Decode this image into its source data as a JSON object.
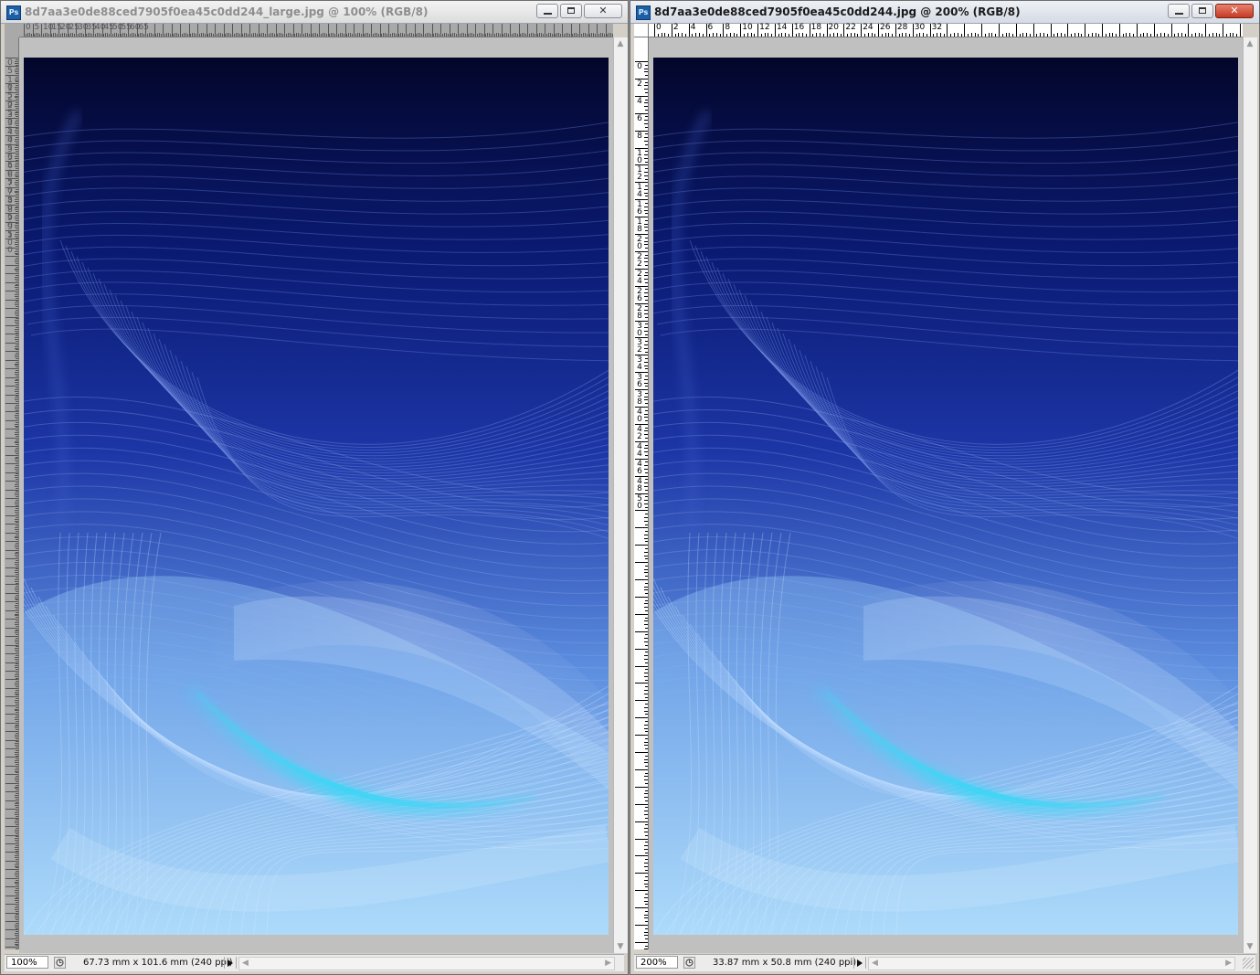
{
  "windows": [
    {
      "title": "8d7aa3e0de88ced7905f0ea45c0dd244_large.jpg @ 100% (RGB/8)",
      "app_icon": "Ps",
      "active": false,
      "zoom": "100%",
      "doc_info": "67.73 mm x 101.6 mm (240 ppi)",
      "ruler_h_labels": [
        "0",
        "5",
        "10",
        "15",
        "20",
        "25",
        "30",
        "35",
        "40",
        "45",
        "50",
        "55",
        "60",
        "65"
      ],
      "ruler_v_labels": [
        "0",
        "5",
        "10",
        "15",
        "20",
        "25",
        "30",
        "35",
        "40",
        "45",
        "50",
        "55",
        "60",
        "65",
        "70",
        "75",
        "80",
        "85",
        "90",
        "95",
        "100"
      ]
    },
    {
      "title": "8d7aa3e0de88ced7905f0ea45c0dd244.jpg @ 200% (RGB/8)",
      "app_icon": "Ps",
      "active": true,
      "zoom": "200%",
      "doc_info": "33.87 mm x 50.8 mm (240 ppi)",
      "ruler_h_labels": [
        "0",
        "2",
        "4",
        "6",
        "8",
        "10",
        "12",
        "14",
        "16",
        "18",
        "20",
        "22",
        "24",
        "26",
        "28",
        "30",
        "32"
      ],
      "ruler_v_labels": [
        "0",
        "2",
        "4",
        "6",
        "8",
        "10",
        "12",
        "14",
        "16",
        "18",
        "20",
        "22",
        "24",
        "26",
        "28",
        "30",
        "32",
        "34",
        "36",
        "38",
        "40",
        "42",
        "44",
        "46",
        "48",
        "50"
      ]
    }
  ],
  "icons": {
    "minimize": "minimize-icon",
    "restore": "restore-icon",
    "close": "close-icon",
    "doc_info_menu": "doc-info-icon",
    "expand_arrow": "play-arrow-icon"
  },
  "colors": {
    "image_top": "#03062a",
    "image_mid": "#1d36a6",
    "image_bottom": "#b6e0fb",
    "cyan_highlight": "#3fd5f5"
  }
}
